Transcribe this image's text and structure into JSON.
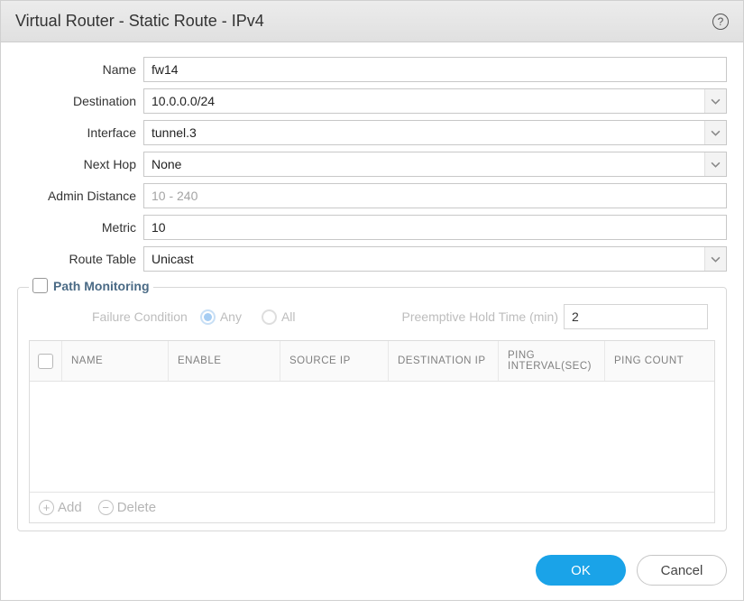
{
  "dialog": {
    "title": "Virtual Router - Static Route - IPv4"
  },
  "form": {
    "name_label": "Name",
    "name_value": "fw14",
    "destination_label": "Destination",
    "destination_value": "10.0.0.0/24",
    "interface_label": "Interface",
    "interface_value": "tunnel.3",
    "nexthop_label": "Next Hop",
    "nexthop_value": "None",
    "admindist_label": "Admin Distance",
    "admindist_placeholder": "10 - 240",
    "admindist_value": "",
    "metric_label": "Metric",
    "metric_value": "10",
    "routetable_label": "Route Table",
    "routetable_value": "Unicast"
  },
  "pathmon": {
    "legend": "Path Monitoring",
    "failure_label": "Failure Condition",
    "any_label": "Any",
    "all_label": "All",
    "hold_label": "Preemptive Hold Time (min)",
    "hold_value": "2",
    "cols": {
      "name": "Name",
      "enable": "Enable",
      "source": "Source IP",
      "dest": "Destination IP",
      "ping": "Ping Interval(sec)",
      "count": "Ping Count"
    },
    "add_label": "Add",
    "delete_label": "Delete"
  },
  "footer": {
    "ok": "OK",
    "cancel": "Cancel"
  }
}
